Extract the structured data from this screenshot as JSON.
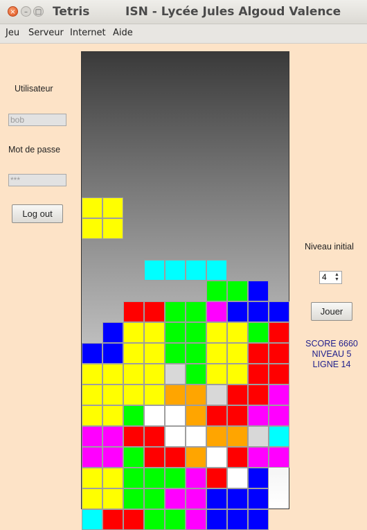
{
  "window": {
    "app_name": "Tetris",
    "title": "ISN - Lycée Jules Algoud Valence"
  },
  "titlebar_buttons": {
    "close": "×",
    "minimize": "–",
    "maximize": "□"
  },
  "menu": [
    "Jeu",
    "Serveur",
    "Internet",
    "Aide"
  ],
  "login": {
    "user_label": "Utilisateur",
    "user_value": "bob",
    "password_label": "Mot de passe",
    "password_value": "***",
    "logout_label": "Log out"
  },
  "controls": {
    "niveau_label": "Niveau initial",
    "niveau_value": "4",
    "jouer_label": "Jouer"
  },
  "status": {
    "score": "SCORE 6660",
    "niveau": "NIVEAU 5",
    "ligne": "LIGNE 14"
  },
  "colors": {
    "Y": "#ffff00",
    "C": "#00ffff",
    "G": "#00ff00",
    "B": "#0000ff",
    "R": "#ff0000",
    "M": "#ff00ff",
    "O": "#ffa500",
    "W": "#ffffff",
    "L": "#d8d8d8"
  },
  "board": [
    "..........",
    "..........",
    "..........",
    "..........",
    "..........",
    "..........",
    "..........",
    "YY........",
    "YY........",
    "..........",
    "...CCCC...",
    "......GGB.",
    "..RRGGMBBB",
    ".BYYGGYYGR",
    "BBYYGGYYRR",
    "YYYYLGYYRR",
    "YYYYOOLRRM",
    "YYGWWORRMM",
    "MMRRWWOOLC",
    "MMGRROWRMM",
    "YYGGGMRWB.",
    "YYGGMMBBB.",
    "CRRGGMBBB."
  ]
}
